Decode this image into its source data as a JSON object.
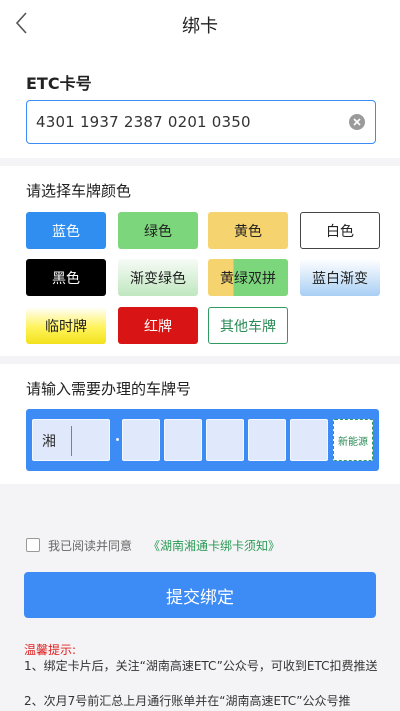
{
  "header": {
    "title": "绑卡",
    "back_icon": "chevron-left-icon"
  },
  "etc": {
    "label": "ETC卡号",
    "value": "4301 1937 2387 0201 0350",
    "clear_icon": "clear-circle-icon"
  },
  "plate_color": {
    "label": "请选择车牌颜色",
    "options": [
      "蓝色",
      "绿色",
      "黄色",
      "白色",
      "黑色",
      "渐变绿色",
      "黄绿双拼",
      "蓝白渐变",
      "临时牌",
      "红牌",
      "其他车牌"
    ]
  },
  "plate_number": {
    "label": "请输入需要办理的车牌号",
    "province": "湘",
    "new_energy": "新能源"
  },
  "agreement": {
    "text": "我已阅读并同意",
    "link": "《湖南湘通卡绑卡须知》"
  },
  "submit_label": "提交绑定",
  "tips": {
    "title": "温馨提示:",
    "items": [
      "1、绑定卡片后，关注“湖南高速ETC”公众号，可收到ETC扣费推送",
      "2、次月7号前汇总上月通行账单并在“湖南高速ETC”公众号推"
    ]
  },
  "colors": {
    "accent": "#3d8bf5",
    "link_green": "#2a9a55",
    "tip_red": "#e02020"
  }
}
